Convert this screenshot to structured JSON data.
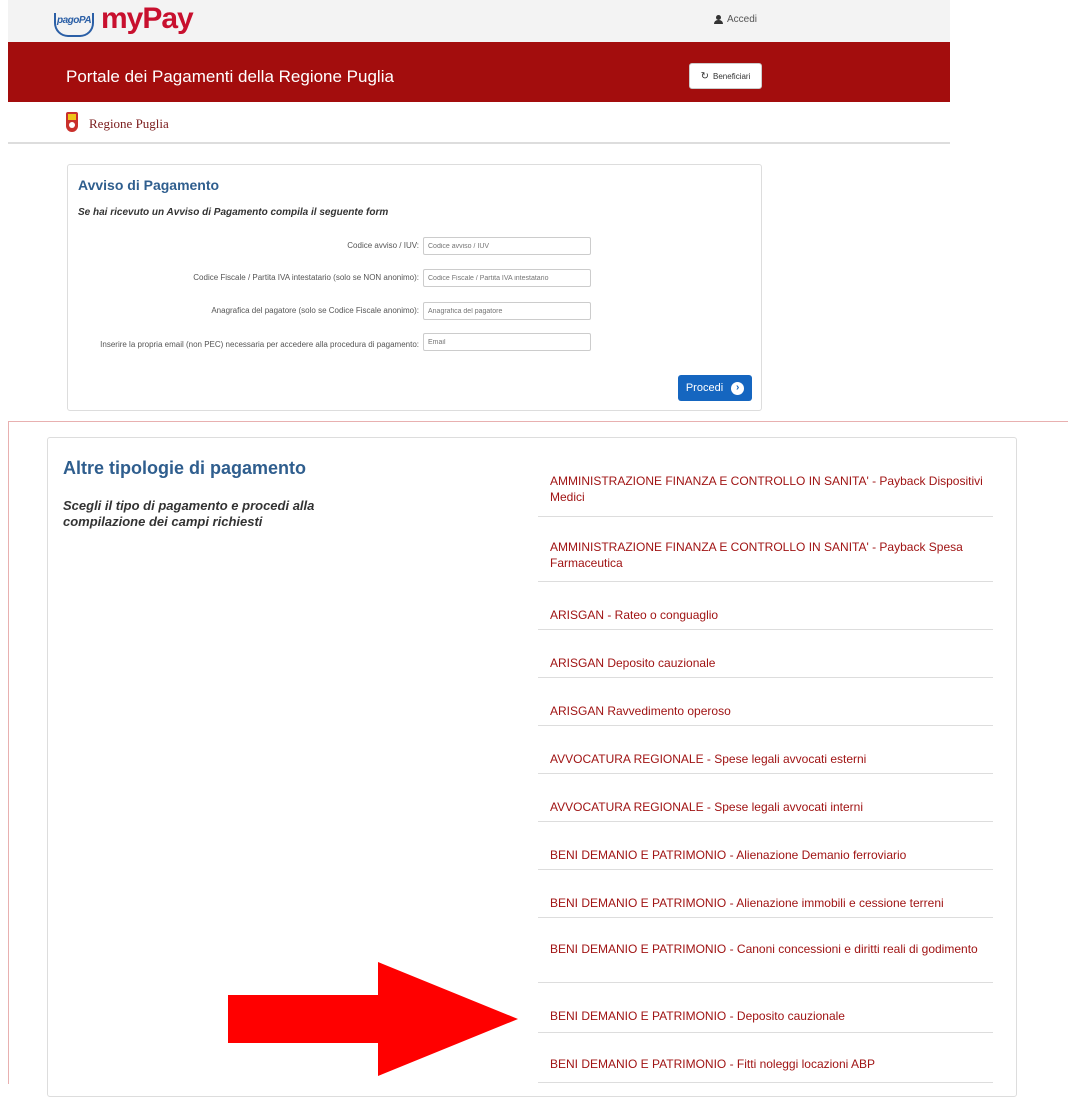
{
  "topbar": {
    "pagopa_logo": "pagoPA",
    "mypay_logo": "myPay",
    "login_label": "Accedi"
  },
  "header": {
    "portal_title": "Portale dei Pagamenti della Regione Puglia",
    "beneficiari_label": "Beneficiari"
  },
  "region": {
    "name": "Regione Puglia"
  },
  "avviso": {
    "title": "Avviso di Pagamento",
    "subtitle": "Se hai ricevuto un Avviso di Pagamento compila il seguente form",
    "fields": [
      {
        "label": "Codice avviso / IUV:",
        "placeholder": "Codice avviso / IUV"
      },
      {
        "label": "Codice Fiscale / Partita IVA intestatario (solo se NON anonimo):",
        "placeholder": "Codice Fiscale / Partita IVA intestatario"
      },
      {
        "label": "Anagrafica del pagatore (solo se Codice Fiscale anonimo):",
        "placeholder": "Anagrafica del pagatore"
      },
      {
        "label": "Inserire la propria email (non PEC) necessaria per accedere alla procedura di pagamento:",
        "placeholder": "Email"
      }
    ],
    "submit_label": "Procedi"
  },
  "altre": {
    "title": "Altre tipologie di pagamento",
    "subtitle": "Scegli il tipo di pagamento e procedi alla compilazione dei campi richiesti",
    "items": [
      "AMMINISTRAZIONE FINANZA E CONTROLLO IN SANITA' - Payback Dispositivi Medici",
      "AMMINISTRAZIONE FINANZA E CONTROLLO IN SANITA' - Payback Spesa Farmaceutica",
      "ARISGAN - Rateo o conguaglio",
      "ARISGAN Deposito cauzionale",
      "ARISGAN Ravvedimento operoso",
      "AVVOCATURA REGIONALE - Spese legali avvocati esterni",
      "AVVOCATURA REGIONALE - Spese legali avvocati interni",
      "BENI DEMANIO E PATRIMONIO - Alienazione Demanio ferroviario",
      "BENI DEMANIO E PATRIMONIO - Alienazione immobili e cessione terreni",
      "BENI DEMANIO E PATRIMONIO - Canoni concessioni e diritti reali di godimento",
      "BENI DEMANIO E PATRIMONIO - Deposito cauzionale",
      "BENI DEMANIO E PATRIMONIO - Fitti noleggi locazioni ABP"
    ]
  },
  "colors": {
    "brand_red": "#a30d0d",
    "link_red": "#a01414",
    "heading_blue": "#2f5e8e",
    "button_blue": "#1566c0",
    "annotation_arrow": "#ff0000"
  }
}
